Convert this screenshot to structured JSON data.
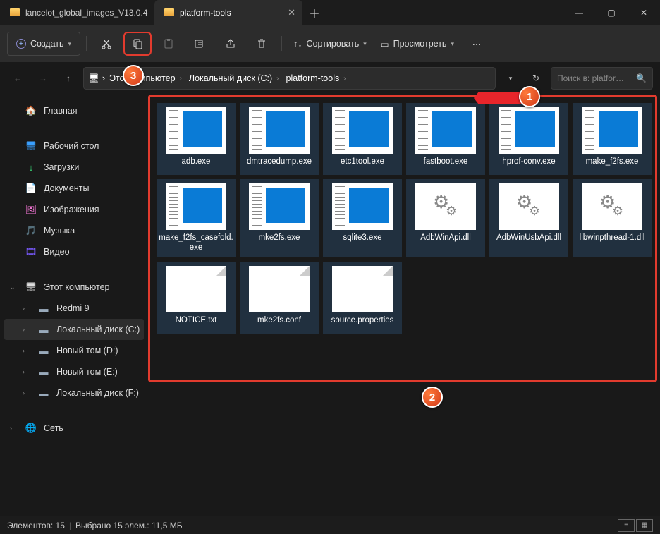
{
  "tabs": [
    {
      "label": "lancelot_global_images_V13.0.4"
    },
    {
      "label": "platform-tools"
    }
  ],
  "toolbar": {
    "new": "Создать",
    "sort": "Сортировать",
    "view": "Просмотреть"
  },
  "breadcrumbs": [
    "Этот компьютер",
    "Локальный диск (C:)",
    "platform-tools"
  ],
  "search_placeholder": "Поиск в: platfor…",
  "sidebar": {
    "home": "Главная",
    "quick": [
      {
        "label": "Рабочий стол",
        "ico": "🖥",
        "color": "#3aa0ff"
      },
      {
        "label": "Загрузки",
        "ico": "↓",
        "color": "#3adf7a"
      },
      {
        "label": "Документы",
        "ico": "📄",
        "color": "#bfcad6"
      },
      {
        "label": "Изображения",
        "ico": "🖼",
        "color": "#ff7adf"
      },
      {
        "label": "Музыка",
        "ico": "🎵",
        "color": "#ff5aa0"
      },
      {
        "label": "Видео",
        "ico": "🎞",
        "color": "#7a5aff"
      }
    ],
    "thispc": "Этот компьютер",
    "drives": [
      {
        "label": "Redmi 9"
      },
      {
        "label": "Локальный диск (C:)",
        "sel": true
      },
      {
        "label": "Новый том (D:)"
      },
      {
        "label": "Новый том (E:)"
      },
      {
        "label": "Локальный диск (F:)"
      }
    ],
    "network": "Сеть"
  },
  "files": [
    {
      "name": "adb.exe",
      "type": "exe"
    },
    {
      "name": "dmtracedump.exe",
      "type": "exe"
    },
    {
      "name": "etc1tool.exe",
      "type": "exe"
    },
    {
      "name": "fastboot.exe",
      "type": "exe"
    },
    {
      "name": "hprof-conv.exe",
      "type": "exe"
    },
    {
      "name": "make_f2fs.exe",
      "type": "exe"
    },
    {
      "name": "make_f2fs_casefold.exe",
      "type": "exe"
    },
    {
      "name": "mke2fs.exe",
      "type": "exe"
    },
    {
      "name": "sqlite3.exe",
      "type": "exe"
    },
    {
      "name": "AdbWinApi.dll",
      "type": "dll"
    },
    {
      "name": "AdbWinUsbApi.dll",
      "type": "dll"
    },
    {
      "name": "libwinpthread-1.dll",
      "type": "dll"
    },
    {
      "name": "NOTICE.txt",
      "type": "txt"
    },
    {
      "name": "mke2fs.conf",
      "type": "txt"
    },
    {
      "name": "source.properties",
      "type": "txt"
    }
  ],
  "status": {
    "count": "Элементов: 15",
    "selected": "Выбрано 15 элем.: 11,5 МБ"
  },
  "badges": {
    "b1": "1",
    "b2": "2",
    "b3": "3"
  }
}
